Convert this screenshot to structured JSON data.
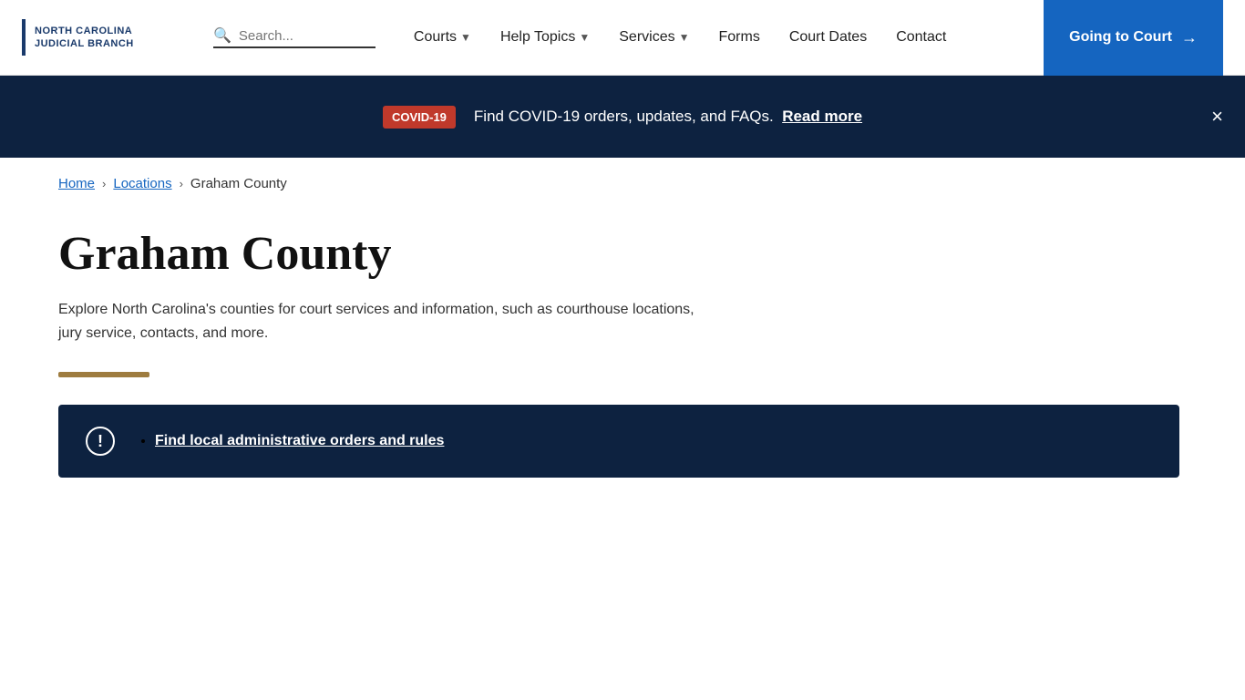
{
  "header": {
    "logo_line1": "NORTH CAROLINA",
    "logo_line2": "JUDICIAL BRANCH",
    "search_placeholder": "Search...",
    "nav": [
      {
        "label": "Courts",
        "has_dropdown": true
      },
      {
        "label": "Help Topics",
        "has_dropdown": true
      },
      {
        "label": "Services",
        "has_dropdown": true
      },
      {
        "label": "Forms",
        "has_dropdown": false
      },
      {
        "label": "Court Dates",
        "has_dropdown": false
      },
      {
        "label": "Contact",
        "has_dropdown": false
      }
    ],
    "cta_label": "Going to Court",
    "cta_arrow": "→"
  },
  "covid_banner": {
    "badge": "COVID-19",
    "text": "Find COVID-19 orders, updates, and FAQs.",
    "link_text": "Read more",
    "close_label": "×"
  },
  "breadcrumb": {
    "home": "Home",
    "locations": "Locations",
    "current": "Graham County"
  },
  "page": {
    "title": "Graham County",
    "description": "Explore North Carolina's counties for court services and information, such as courthouse locations, jury service, contacts, and more."
  },
  "info_box": {
    "link_text": "Find local administrative orders and rules"
  }
}
